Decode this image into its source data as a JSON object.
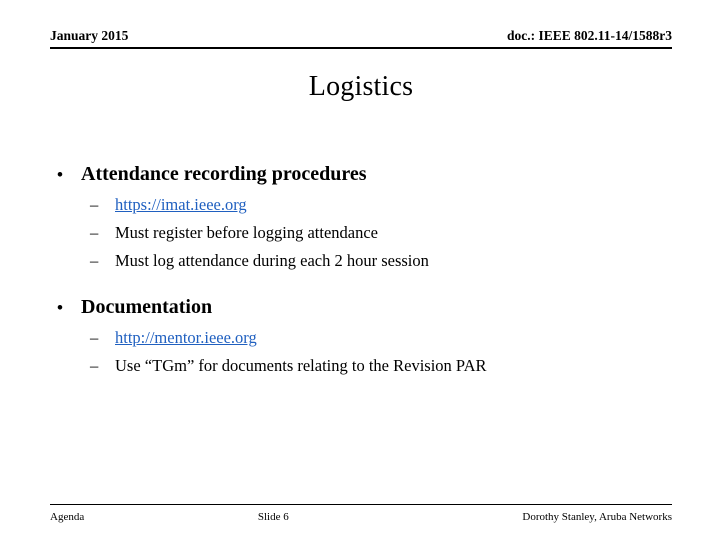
{
  "header": {
    "date": "January 2015",
    "doc_number": "doc.: IEEE 802.11-14/1588r3"
  },
  "title": "Logistics",
  "body": {
    "blocks": [
      {
        "bullet_marker": "•",
        "heading": "Attendance recording procedures",
        "items": [
          {
            "marker": "–",
            "text": "https://imat.ieee.org",
            "is_link": true
          },
          {
            "marker": "–",
            "text": "Must register before logging attendance",
            "is_link": false
          },
          {
            "marker": "–",
            "text": "Must log attendance during each 2 hour session",
            "is_link": false
          }
        ]
      },
      {
        "bullet_marker": "•",
        "heading": "Documentation",
        "items": [
          {
            "marker": "–",
            "text": "http://mentor.ieee.org",
            "is_link": true
          },
          {
            "marker": "–",
            "text": "Use “TGm” for documents relating to the Revision PAR",
            "is_link": false
          }
        ]
      }
    ]
  },
  "footer": {
    "left": "Agenda",
    "center": "Slide 6",
    "right": "Dorothy Stanley, Aruba Networks"
  },
  "colors": {
    "hyperlink": "#2060C0",
    "text": "#000000",
    "background": "#FFFFFF"
  }
}
